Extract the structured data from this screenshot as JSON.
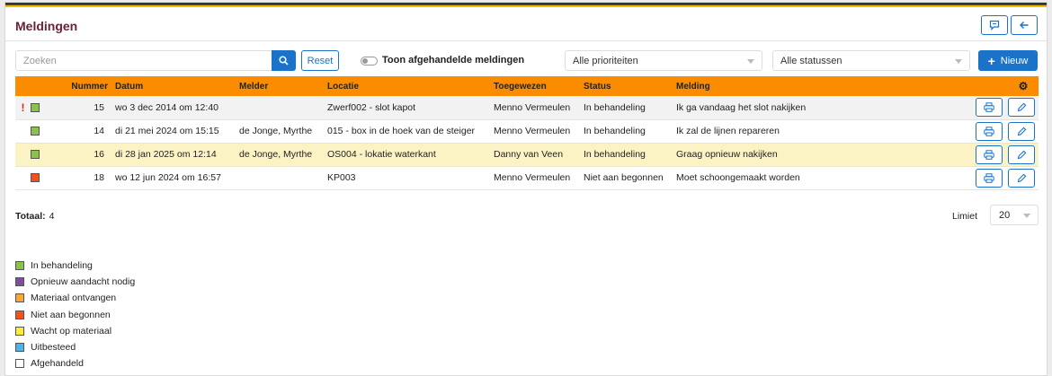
{
  "header": {
    "title": "Meldingen",
    "feedback_icon": "chat-icon",
    "back_icon": "arrow-left-icon"
  },
  "toolbar": {
    "search_placeholder": "Zoeken",
    "reset_label": "Reset",
    "toggle_label": "Toon afgehandelde meldingen",
    "priority_select": "Alle prioriteiten",
    "status_select": "Alle statussen",
    "new_label": "Nieuw"
  },
  "table": {
    "columns": [
      "Nummer",
      "Datum",
      "Melder",
      "Locatie",
      "Toegewezen",
      "Status",
      "Melding"
    ],
    "rows": [
      {
        "flag": "!",
        "color": "#8bc34a",
        "nummer": "15",
        "datum": "wo 3 dec 2014 om 12:40",
        "melder": "",
        "locatie": "Zwerf002 - slot kapot",
        "toegewezen": "Menno Vermeulen",
        "status": "In behandeling",
        "melding": "Ik ga vandaag het slot nakijken"
      },
      {
        "flag": "",
        "color": "#8bc34a",
        "nummer": "14",
        "datum": "di 21 mei 2024 om 15:15",
        "melder": "de Jonge, Myrthe",
        "locatie": "015 - box in de hoek van de steiger",
        "toegewezen": "Menno Vermeulen",
        "status": "In behandeling",
        "melding": "Ik zal de lijnen repareren"
      },
      {
        "flag": "",
        "color": "#8bc34a",
        "nummer": "16",
        "datum": "di 28 jan 2025 om 12:14",
        "melder": "de Jonge, Myrthe",
        "locatie": "OS004 - lokatie waterkant",
        "toegewezen": "Danny van Veen",
        "status": "In behandeling",
        "melding": "Graag opnieuw nakijken"
      },
      {
        "flag": "",
        "color": "#f4511e",
        "nummer": "18",
        "datum": "wo 12 jun 2024 om 16:57",
        "melder": "",
        "locatie": "KP003",
        "toegewezen": "Menno Vermeulen",
        "status": "Niet aan begonnen",
        "melding": "Moet schoongemaakt worden"
      }
    ]
  },
  "footer": {
    "total_label": "Totaal:",
    "total_value": "4",
    "limit_label": "Limiet",
    "limit_value": "20"
  },
  "legend": [
    {
      "label": "In behandeling",
      "color": "#8bc34a"
    },
    {
      "label": "Opnieuw aandacht nodig",
      "color": "#7e4fa0"
    },
    {
      "label": "Materiaal ontvangen",
      "color": "#f5a742"
    },
    {
      "label": "Niet aan begonnen",
      "color": "#f4511e"
    },
    {
      "label": "Wacht op materiaal",
      "color": "#ffeb3b"
    },
    {
      "label": "Uitbesteed",
      "color": "#4fb3e8"
    },
    {
      "label": "Afgehandeld",
      "color": "#ffffff"
    }
  ]
}
